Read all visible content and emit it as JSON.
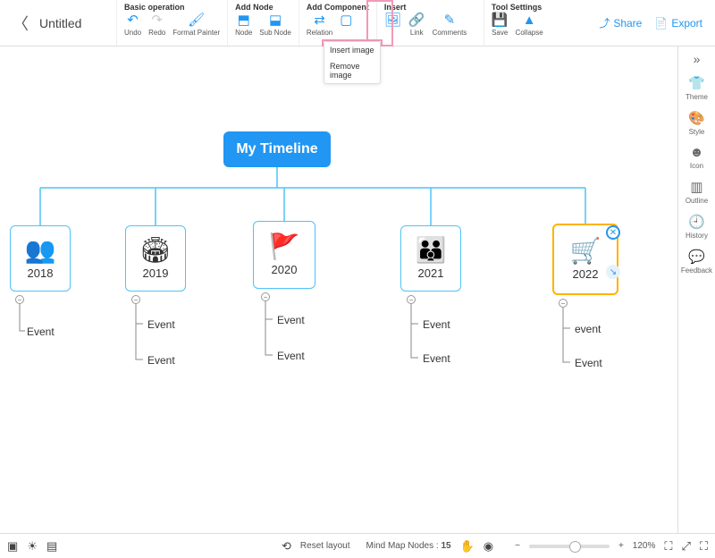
{
  "header": {
    "title": "Untitled",
    "share": "Share",
    "export": "Export"
  },
  "groups": {
    "basic": {
      "label": "Basic operation",
      "undo": "Undo",
      "redo": "Redo",
      "fmt": "Format Painter"
    },
    "addnode": {
      "label": "Add Node",
      "node": "Node",
      "subnode": "Sub Node"
    },
    "addcomp": {
      "label": "Add Component",
      "relation": "Relation"
    },
    "insert": {
      "label": "Insert",
      "image": "",
      "link": "Link",
      "comments": "Comments"
    },
    "tools": {
      "label": "Tool Settings",
      "save": "Save",
      "collapse": "Collapse"
    }
  },
  "dropdown": {
    "insert_image": "Insert image",
    "remove_image": "Remove image"
  },
  "rside": {
    "theme": "Theme",
    "style": "Style",
    "icon": "Icon",
    "outline": "Outline",
    "history": "History",
    "feedback": "Feedback"
  },
  "map": {
    "root": "My Timeline",
    "nodes": [
      {
        "year": "2018",
        "events": [
          "Event"
        ]
      },
      {
        "year": "2019",
        "events": [
          "Event",
          "Event"
        ]
      },
      {
        "year": "2020",
        "events": [
          "Event",
          "Event"
        ]
      },
      {
        "year": "2021",
        "events": [
          "Event",
          "Event"
        ]
      },
      {
        "year": "2022",
        "events": [
          "event",
          "Event"
        ]
      }
    ]
  },
  "status": {
    "reset": "Reset layout",
    "nodes_label": "Mind Map Nodes :",
    "nodes_count": "15",
    "zoom": "120%"
  }
}
